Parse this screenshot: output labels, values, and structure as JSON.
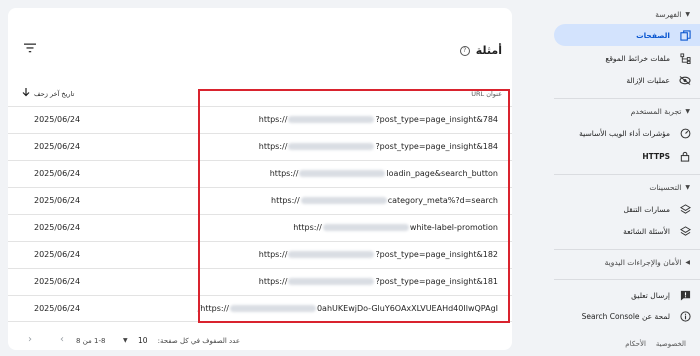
{
  "sidebar": {
    "index_section": "الفهرسة",
    "pages": "الصفحات",
    "sitemaps": "ملفات خرائط الموقع",
    "removals": "عمليات الإزالة",
    "experience_section": "تجربة المستخدم",
    "core_web_vitals": "مؤشرات أداء الويب الأساسية",
    "https": "HTTPS",
    "enhancements_section": "التحسينات",
    "breadcrumbs": "مسارات التنقل",
    "faq": "الأسئلة الشائعة",
    "security_section": "الأمان والإجراءات اليدوية",
    "submit_feedback": "إرسال تعليق",
    "about": "لمحة عن Search Console",
    "privacy": "الخصوصية",
    "terms": "الأحكام"
  },
  "card": {
    "title": "أمثلة",
    "col_url": "عنوان URL",
    "col_date": "تاريخ آخر زحف"
  },
  "rows": [
    {
      "prefix": "https://",
      "suffix": "?post_type=page_insight&784",
      "date": "2025/06/24"
    },
    {
      "prefix": "https://",
      "suffix": "?post_type=page_insight&184",
      "date": "2025/06/24"
    },
    {
      "prefix": "https://",
      "suffix": "loadin_page&search_button",
      "date": "2025/06/24"
    },
    {
      "prefix": "https://",
      "suffix": "category_meta%?d=search",
      "date": "2025/06/24"
    },
    {
      "prefix": "https://",
      "suffix": "white-label-promotion",
      "date": "2025/06/24"
    },
    {
      "prefix": "https://",
      "suffix": "?post_type=page_insight&182",
      "date": "2025/06/24"
    },
    {
      "prefix": "https://",
      "suffix": "?post_type=page_insight&181",
      "date": "2025/06/24"
    },
    {
      "prefix": "/https://",
      "suffix": "0ahUKEwjDo-GluY6OAxXLVUEAHd40IlwQPAgI",
      "date": "2025/06/24"
    }
  ],
  "pager": {
    "rows_per_page_label": "عدد الصفوف في كل صفحة:",
    "rows_per_page_value": "10",
    "range": "1-8 من 8"
  },
  "colors": {
    "accent": "#0b57d0",
    "active_bg": "#d3e3fd",
    "highlight": "#d9232e"
  }
}
